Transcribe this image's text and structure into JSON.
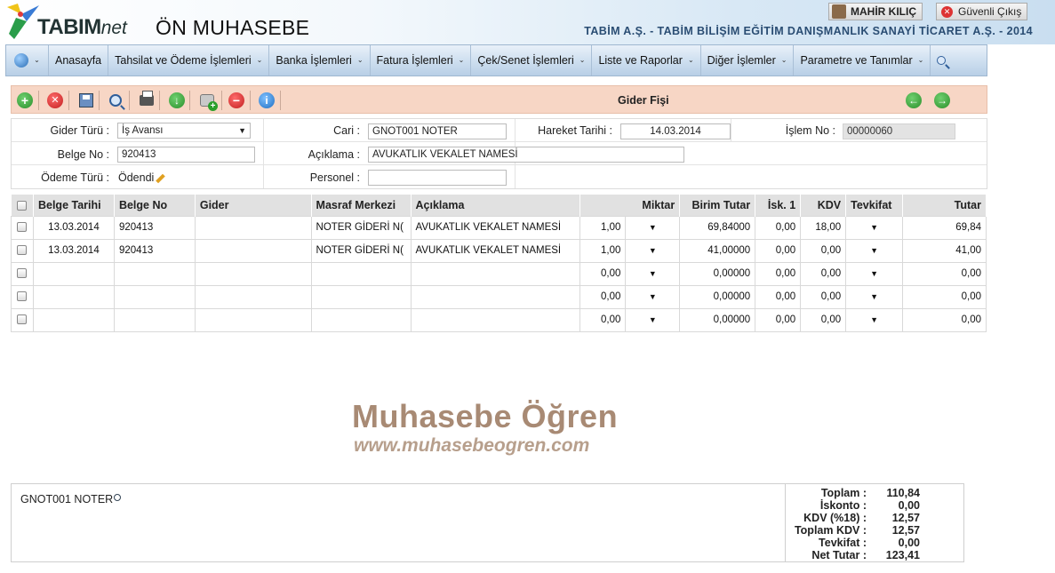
{
  "header": {
    "brand_bold": "TABIM",
    "brand_italic": "net",
    "app_title": "ÖN MUHASEBE",
    "user_name": "MAHİR KILIÇ",
    "logout_label": "Güvenli Çıkış",
    "company": "TABİM A.Ş. - TABİM BİLİŞİM EĞİTİM DANIŞMANLIK SANAYİ TİCARET A.Ş. - 2014"
  },
  "menu": {
    "items": [
      "Anasayfa",
      "Tahsilat ve Ödeme İşlemleri",
      "Banka İşlemleri",
      "Fatura İşlemleri",
      "Çek/Senet İşlemleri",
      "Liste ve Raporlar",
      "Diğer İşlemler",
      "Parametre ve Tanımlar"
    ]
  },
  "toolbar": {
    "title": "Gider Fişi"
  },
  "form": {
    "gider_turu_label": "Gider Türü :",
    "gider_turu_value": "İş Avansı",
    "cari_label": "Cari :",
    "cari_value": "GNOT001 NOTER",
    "hareket_tarihi_label": "Hareket Tarihi :",
    "hareket_tarihi_value": "14.03.2014",
    "islem_no_label": "İşlem No :",
    "islem_no_value": "00000060",
    "belge_no_label": "Belge No :",
    "belge_no_value": "920413",
    "aciklama_label": "Açıklama :",
    "aciklama_value": "AVUKATLIK VEKALET NAMESİ",
    "odeme_turu_label": "Ödeme Türü :",
    "odeme_turu_value": "Ödendi",
    "personel_label": "Personel :",
    "personel_value": ""
  },
  "table": {
    "columns": [
      "Belge Tarihi",
      "Belge No",
      "Gider",
      "Masraf Merkezi",
      "Açıklama",
      "Miktar",
      "Birim Tutar",
      "İsk. 1",
      "KDV",
      "Tevkifat",
      "Tutar"
    ],
    "rows": [
      {
        "belge_tarihi": "13.03.2014",
        "belge_no": "920413",
        "gider": "",
        "masraf": "NOTER GİDERİ N(",
        "aciklama": "AVUKATLIK VEKALET NAMESİ",
        "miktar": "1,00",
        "birim": "69,84000",
        "isk": "0,00",
        "kdv": "18,00",
        "tutar": "69,84"
      },
      {
        "belge_tarihi": "13.03.2014",
        "belge_no": "920413",
        "gider": "",
        "masraf": "NOTER GİDERİ N(",
        "aciklama": "AVUKATLIK VEKALET NAMESİ",
        "miktar": "1,00",
        "birim": "41,00000",
        "isk": "0,00",
        "kdv": "0,00",
        "tutar": "41,00"
      },
      {
        "belge_tarihi": "",
        "belge_no": "",
        "gider": "",
        "masraf": "",
        "aciklama": "",
        "miktar": "0,00",
        "birim": "0,00000",
        "isk": "0,00",
        "kdv": "0,00",
        "tutar": "0,00"
      },
      {
        "belge_tarihi": "",
        "belge_no": "",
        "gider": "",
        "masraf": "",
        "aciklama": "",
        "miktar": "0,00",
        "birim": "0,00000",
        "isk": "0,00",
        "kdv": "0,00",
        "tutar": "0,00"
      },
      {
        "belge_tarihi": "",
        "belge_no": "",
        "gider": "",
        "masraf": "",
        "aciklama": "",
        "miktar": "0,00",
        "birim": "0,00000",
        "isk": "0,00",
        "kdv": "0,00",
        "tutar": "0,00"
      }
    ]
  },
  "watermark": {
    "title": "Muhasebe Öğren",
    "url": "www.muhasebeogren.com"
  },
  "footer": {
    "cari_text": "GNOT001 NOTER",
    "totals": [
      {
        "label": "Toplam :",
        "value": "110,84"
      },
      {
        "label": "İskonto :",
        "value": "0,00"
      },
      {
        "label": "KDV (%18) :",
        "value": "12,57"
      },
      {
        "label": "Toplam KDV :",
        "value": "12,57"
      },
      {
        "label": "Tevkifat :",
        "value": "0,00"
      },
      {
        "label": "Net Tutar :",
        "value": "123,41"
      }
    ]
  },
  "colors": {
    "toolbar_bg": "#f7d6c5",
    "company_text": "#2a4d73",
    "watermark": "#a88a74"
  }
}
